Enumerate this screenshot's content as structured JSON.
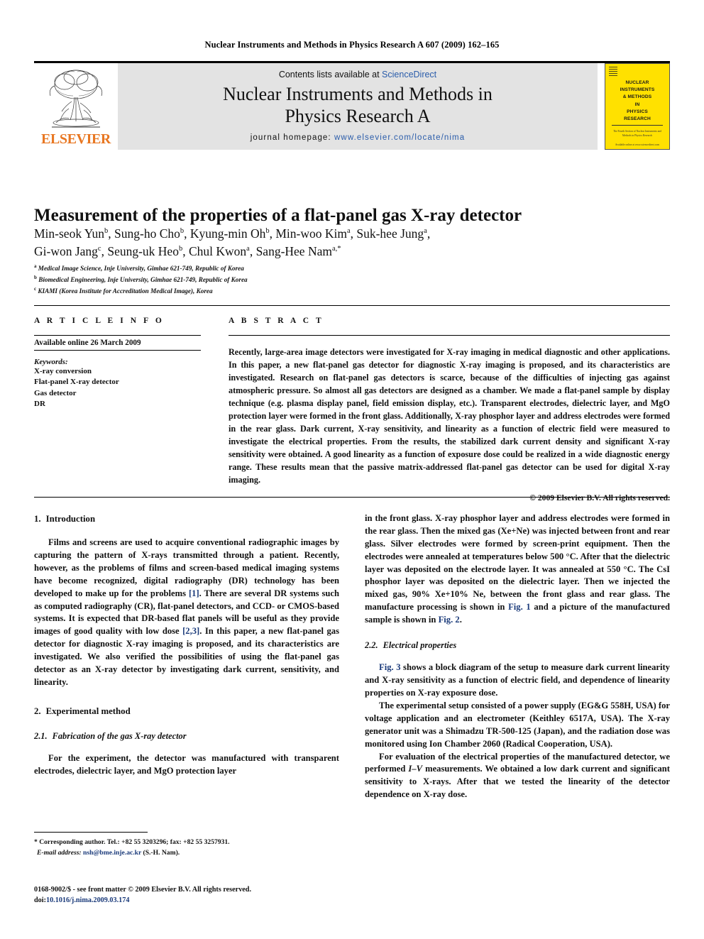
{
  "running_head": "Nuclear Instruments and Methods in Physics Research A 607 (2009) 162–165",
  "masthead": {
    "publisher_name": "ELSEVIER",
    "contents_prefix": "Contents lists available at ",
    "contents_link": "ScienceDirect",
    "journal_title_line1": "Nuclear Instruments and Methods in",
    "journal_title_line2": "Physics Research A",
    "homepage_prefix": "journal homepage: ",
    "homepage_url": "www.elsevier.com/locate/nima",
    "cover": {
      "title_lines": [
        "NUCLEAR",
        "INSTRUMENTS",
        "& METHODS",
        "IN",
        "PHYSICS",
        "RESEARCH"
      ],
      "blurb": "The Fourth  Section of Nuclear Instruments and Methods in Physics Research",
      "foot": "Available online at www.sciencedirect.com"
    }
  },
  "article": {
    "title": "Measurement of the properties of a flat-panel gas X-ray detector",
    "authors_line1": "Min-seok Yun b, Sung-ho Cho b, Kyung-min Oh b, Min-woo Kim a, Suk-hee Jung a,",
    "authors_line2": "Gi-won Jang c, Seung-uk Heo b, Chul Kwon a, Sang-Hee Nam a,*",
    "authors": [
      {
        "name": "Min-seok Yun",
        "sup": "b",
        "sep": ","
      },
      {
        "name": "Sung-ho Cho",
        "sup": "b",
        "sep": ","
      },
      {
        "name": "Kyung-min Oh",
        "sup": "b",
        "sep": ","
      },
      {
        "name": "Min-woo Kim",
        "sup": "a",
        "sep": ","
      },
      {
        "name": "Suk-hee Jung",
        "sup": "a",
        "sep": ","
      },
      {
        "name": "Gi-won Jang",
        "sup": "c",
        "sep": ","
      },
      {
        "name": "Seung-uk Heo",
        "sup": "b",
        "sep": ","
      },
      {
        "name": "Chul Kwon",
        "sup": "a",
        "sep": ","
      },
      {
        "name": "Sang-Hee Nam",
        "sup": "a,*",
        "sep": ""
      }
    ],
    "affiliations": [
      {
        "sup": "a",
        "text": "Medical Image Science, Inje University, Gimhae 621-749, Republic of Korea"
      },
      {
        "sup": "b",
        "text": "Biomedical Engineering, Inje University, Gimhae 621-749, Republic of Korea"
      },
      {
        "sup": "c",
        "text": "KIAMI (Korea Institute for Accreditation Medical Image), Korea"
      }
    ]
  },
  "article_info": {
    "heading": "A R T I C L E   I N F O",
    "history": "Available online 26 March 2009",
    "keywords_label": "Keywords:",
    "keywords": [
      "X-ray conversion",
      "Flat-panel X-ray detector",
      "Gas detector",
      "DR"
    ]
  },
  "abstract": {
    "heading": "A B S T R A C T",
    "text": "Recently, large-area image detectors were investigated for X-ray imaging in medical diagnostic and other applications. In this paper, a new flat-panel gas detector for diagnostic X-ray imaging is proposed, and its characteristics are investigated. Research on flat-panel gas detectors is scarce, because of the difficulties of injecting gas against atmospheric pressure. So almost all gas detectors are designed as a chamber. We made a flat-panel sample by display technique (e.g. plasma display panel, field emission display, etc.). Transparent electrodes, dielectric layer, and MgO protection layer were formed in the front glass. Additionally, X-ray phosphor layer and address electrodes were formed in the rear glass. Dark current, X-ray sensitivity, and linearity as a function of electric field were measured to investigate the electrical properties. From the results, the stabilized dark current density and significant X-ray sensitivity were obtained. A good linearity as a function of exposure dose could be realized in a wide diagnostic energy range. These results mean that the passive matrix-addressed flat-panel gas detector can be used for digital X-ray imaging.",
    "copyright": "© 2009 Elsevier B.V. All rights reserved."
  },
  "sections": {
    "intro": {
      "number": "1.",
      "heading": "Introduction",
      "p1_a": "Films and screens are used to acquire conventional radiographic images by capturing the pattern of X-rays transmitted through a patient. Recently, however, as the problems of films and screen-based medical imaging systems have become recognized, digital radiography (DR) technology has been developed to make up for the problems ",
      "p1_ref1": "[1]",
      "p1_b": ". There are several DR systems such as computed radiography (CR), flat-panel detectors, and CCD- or CMOS-based systems. It is expected that DR-based flat panels will be useful as they provide images of good quality with low dose ",
      "p1_ref2": "[2,3]",
      "p1_c": ". In this paper, a new flat-panel gas detector for diagnostic X-ray imaging is proposed, and its characteristics are investigated. We also verified the possibilities of using the flat-panel gas detector as an X-ray detector by investigating dark current, sensitivity, and linearity."
    },
    "experimental": {
      "number": "2.",
      "heading": "Experimental method",
      "sub1_number": "2.1.",
      "sub1_heading": "Fabrication of the gas X-ray detector",
      "sub1_p1_left": "For the experiment, the detector was manufactured with transparent electrodes, dielectric layer, and MgO protection layer",
      "sub1_p1_right_a": "in the front glass. X-ray phosphor layer and address electrodes were formed in the rear glass. Then the mixed gas (Xe+Ne) was injected between front and rear glass. Silver electrodes were formed by screen-print equipment. Then the electrodes were annealed at temperatures below 500 °C. After that the dielectric layer was deposited on the electrode layer. It was annealed at 550 °C. The CsI phosphor layer was deposited on the dielectric layer. Then we injected the mixed gas, 90% Xe+10% Ne, between the front glass and rear glass. The manufacture processing is shown in ",
      "sub1_p1_fig1": "Fig. 1",
      "sub1_p1_right_b": " and a picture of the manufactured sample is shown in ",
      "sub1_p1_fig2": "Fig. 2",
      "sub1_p1_right_c": ".",
      "sub2_number": "2.2.",
      "sub2_heading": "Electrical properties",
      "sub2_p1_fig3": "Fig. 3",
      "sub2_p1_a": " shows a block diagram of the setup to measure dark current linearity and X-ray sensitivity as a function of electric field, and dependence of linearity properties on X-ray exposure dose.",
      "sub2_p2": "The experimental setup consisted of a power supply (EG&G 558H, USA) for voltage application and an electrometer (Keithley 6517A, USA). The X-ray generator unit was a Shimadzu TR-500-125 (Japan), and the radiation dose was monitored using Ion Chamber 2060 (Radical Cooperation, USA).",
      "sub2_p3_a": "For evaluation of the electrical properties of the manufactured detector, we performed ",
      "sub2_p3_ital": "I–V",
      "sub2_p3_b": " measurements. We obtained a low dark current and significant sensitivity to X-rays. After that we tested the linearity of the detector dependence on X-ray dose."
    }
  },
  "footnotes": {
    "corresponding": "* Corresponding author. Tel.: +82 55 3203296; fax: +82 55 3257931.",
    "email_label": "E-mail address:",
    "email": "nsh@bme.inje.ac.kr",
    "email_suffix": "(S.-H. Nam)."
  },
  "colophon": {
    "line1": "0168-9002/$ - see front matter © 2009 Elsevier B.V. All rights reserved.",
    "doi_label": "doi:",
    "doi": "10.1016/j.nima.2009.03.174"
  },
  "colors": {
    "link_blue": "#2a5caa",
    "ref_blue": "#1a3a7a",
    "elsevier_orange": "#e87722",
    "banner_gray": "#e3e3e3",
    "cover_yellow": "#ffe100"
  }
}
